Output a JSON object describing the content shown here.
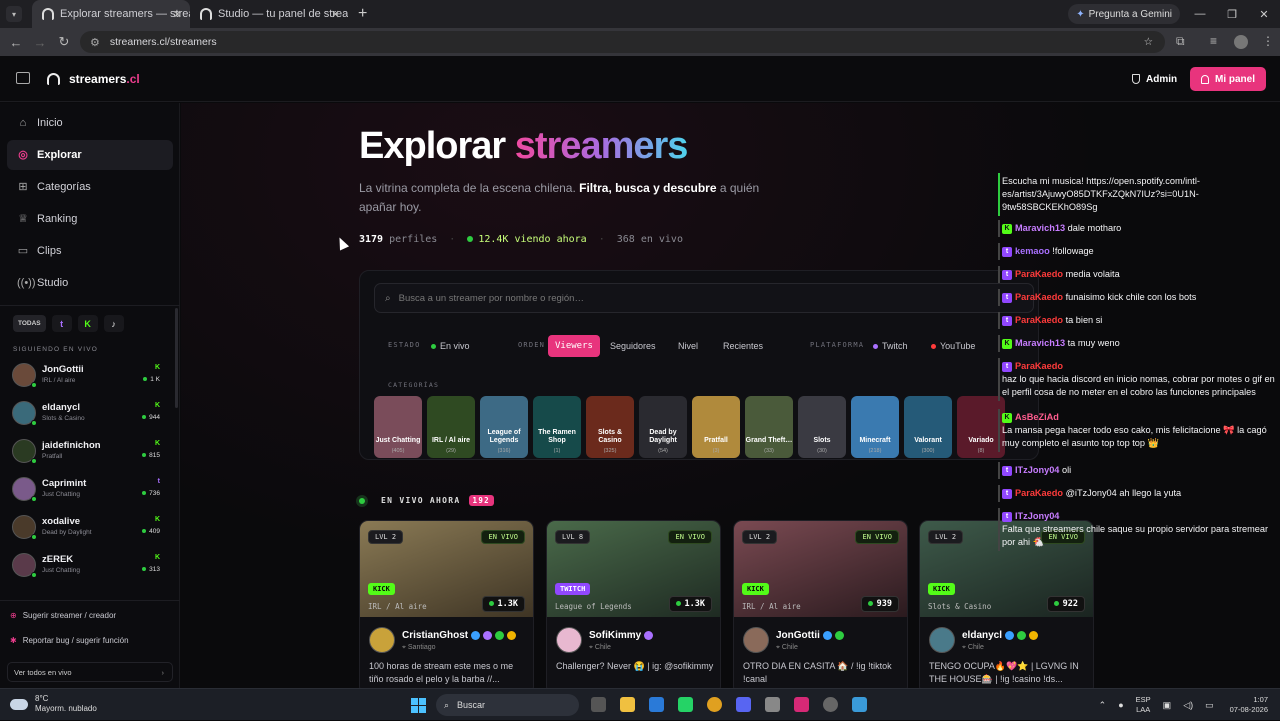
{
  "browser": {
    "tabs": [
      {
        "title": "Explorar streamers — streamers.cl",
        "active": true
      },
      {
        "title": "Studio — tu panel de streamer",
        "active": false
      }
    ],
    "gemini": "Pregunta a Gemini",
    "url": "streamers.cl/streamers"
  },
  "header": {
    "logo": "streamers",
    "logo_tld": ".cl",
    "admin": "Admin",
    "mi_panel": "Mi panel"
  },
  "sidebar": {
    "nav": [
      {
        "label": "Inicio",
        "icon": "home-icon"
      },
      {
        "label": "Explorar",
        "icon": "compass-icon",
        "active": true
      },
      {
        "label": "Categorías",
        "icon": "grid-icon"
      },
      {
        "label": "Ranking",
        "icon": "trophy-icon"
      },
      {
        "label": "Clips",
        "icon": "film-icon"
      },
      {
        "label": "Studio",
        "icon": "broadcast-icon"
      }
    ],
    "filter_tabs": [
      "TODAS",
      "t",
      "K",
      "♪"
    ],
    "following_heading": "SIGUIENDO EN VIVO",
    "following": [
      {
        "name": "JonGottii",
        "game": "IRL / Al aire",
        "platform": "K",
        "viewers": "1 K"
      },
      {
        "name": "eldanycl",
        "game": "Slots & Casino",
        "platform": "K",
        "viewers": "944"
      },
      {
        "name": "jaidefinichon",
        "game": "Pratfall",
        "platform": "K",
        "viewers": "815"
      },
      {
        "name": "Caprimint",
        "game": "Just Chatting",
        "platform": "t",
        "viewers": "736"
      },
      {
        "name": "xodalive",
        "game": "Dead by Daylight",
        "platform": "K",
        "viewers": "409"
      },
      {
        "name": "zEREK",
        "game": "Just Chatting",
        "platform": "K",
        "viewers": "313"
      }
    ],
    "suggest": "Sugerir streamer / creador",
    "report": "Reportar bug / sugerir función",
    "see_all": "Ver todos en vivo"
  },
  "main": {
    "title_a": "Explorar ",
    "title_b": "streamers",
    "intro_a": "La vitrina completa de la escena chilena. ",
    "intro_b": "Filtra, busca y descubre",
    "intro_c": " a quién apañar hoy.",
    "stats": {
      "profiles_num": "3179",
      "profiles_label": "perfiles",
      "watching": "12.4K viendo ahora",
      "live_num": "368",
      "live_label": "en vivo"
    },
    "search_placeholder": "Busca a un streamer por nombre o región…",
    "filters": {
      "estado_label": "ESTADO",
      "estado": "En vivo",
      "orden_label": "ORDEN",
      "orden": [
        "Viewers",
        "Seguidores",
        "Nivel",
        "Recientes"
      ],
      "plataforma_label": "PLATAFORMA",
      "plataformas": [
        "Twitch",
        "YouTube"
      ]
    },
    "categories_heading": "CATEGORÍAS",
    "categories": [
      {
        "name": "Just Chatting",
        "count": "(405)",
        "color": "#7a4c5a"
      },
      {
        "name": "IRL / Al aire",
        "count": "(29)",
        "color": "#2f4a22"
      },
      {
        "name": "League of Legends",
        "count": "(316)",
        "color": "#3d6a85"
      },
      {
        "name": "The Ramen Shop",
        "count": "(1)",
        "color": "#164a4a"
      },
      {
        "name": "Slots & Casino",
        "count": "(325)",
        "color": "#6b2a1c"
      },
      {
        "name": "Dead by Daylight",
        "count": "(54)",
        "color": "#2a2a30"
      },
      {
        "name": "Pratfall",
        "count": "(3)",
        "color": "#b08a3c"
      },
      {
        "name": "Grand Theft…",
        "count": "(33)",
        "color": "#4a5a3a"
      },
      {
        "name": "Slots",
        "count": "(30)",
        "color": "#3a3a42"
      },
      {
        "name": "Minecraft",
        "count": "(218)",
        "color": "#3a7ab0"
      },
      {
        "name": "Valorant",
        "count": "(300)",
        "color": "#255a78"
      },
      {
        "name": "Variado",
        "count": "(8)",
        "color": "#5a1a2a"
      }
    ],
    "live_heading": "EN VIVO AHORA",
    "live_count": "192",
    "cards": [
      {
        "level": "LVL 2",
        "status": "EN VIVO",
        "platform": "KICK",
        "game": "IRL / Al aire",
        "viewers": "1.3K",
        "name": "CristianGhost",
        "location": "Santiago",
        "desc": "100 horas de stream este mes o me tiño rosado el pelo y la barba //...",
        "thumb": "#6a5a3e"
      },
      {
        "level": "LVL 8",
        "status": "EN VIVO",
        "platform": "TWITCH",
        "game": "League of Legends",
        "viewers": "1.3K",
        "name": "SofiKimmy",
        "location": "Chile",
        "desc": "Challenger? Never 😭 | ig: @sofikimmy",
        "thumb": "#2f4a3a"
      },
      {
        "level": "LVL 2",
        "status": "EN VIVO",
        "platform": "KICK",
        "game": "IRL / Al aire",
        "viewers": "939",
        "name": "JonGottii",
        "location": "Chile",
        "desc": "OTRO DIA EN CASITA 🏠 / !ig !tiktok !canal",
        "thumb": "#4a2f36"
      },
      {
        "level": "LVL 2",
        "status": "EN VIVO",
        "platform": "KICK",
        "game": "Slots & Casino",
        "viewers": "922",
        "name": "eldanycl",
        "location": "Chile",
        "desc": "TENGO OCUPA🔥💖⭐ | LGVNG IN THE HOUSE🎰 | !ig !casino !ds...",
        "thumb": "#2e3a34"
      }
    ]
  },
  "chat": [
    {
      "platform": "",
      "user": "",
      "user_color": "#ffffff",
      "text": "Escucha mi musica! https://open.spotify.com/intl-es/artist/3AjuwyO85DTKFxZQkN7IUz?si=0U1N-9tw58SBCKEKhO89Sg"
    },
    {
      "platform": "K",
      "user": "Maravich13",
      "user_color": "#c77dff",
      "text": "dale motharo"
    },
    {
      "platform": "t",
      "user": "kemaoo",
      "user_color": "#a970ff",
      "text": "!followage"
    },
    {
      "platform": "t",
      "user": "ParaKaedo",
      "user_color": "#ff3b3b",
      "text": "media volaita"
    },
    {
      "platform": "t",
      "user": "ParaKaedo",
      "user_color": "#ff3b3b",
      "text": "funaisimo kick chile con los bots"
    },
    {
      "platform": "t",
      "user": "ParaKaedo",
      "user_color": "#ff3b3b",
      "text": "ta bien si"
    },
    {
      "platform": "K",
      "user": "Maravich13",
      "user_color": "#c77dff",
      "text": "ta muy weno"
    },
    {
      "platform": "t",
      "user": "ParaKaedo",
      "user_color": "#ff3b3b",
      "text": "haz lo que hacia discord en inicio nomas, cobrar por motes o gif en el perfil cosa de no meter en el cobro las funciones principales"
    },
    {
      "platform": "K",
      "user": "AsBeZiAd",
      "user_color": "#ff5d8f",
      "text": "La mansa pega hacer todo eso cako, mis felicitacione 🎀 la cagó muy completo el asunto top top top 👑"
    },
    {
      "platform": "t",
      "user": "ITzJony04",
      "user_color": "#c77dff",
      "text": "oli"
    },
    {
      "platform": "t",
      "user": "ParaKaedo",
      "user_color": "#ff3b3b",
      "text": "@iTzJony04 ah llego la yuta"
    },
    {
      "platform": "t",
      "user": "ITzJony04",
      "user_color": "#c77dff",
      "text": "Falta que streamers chile saque su propio servidor para stremear por ahi 🐔"
    }
  ],
  "taskbar": {
    "temp": "8°C",
    "weather": "Mayorm. nublado",
    "search": "Buscar",
    "lang_a": "ESP",
    "lang_b": "LAA",
    "time": "1:07",
    "date": "07-08-2026"
  }
}
